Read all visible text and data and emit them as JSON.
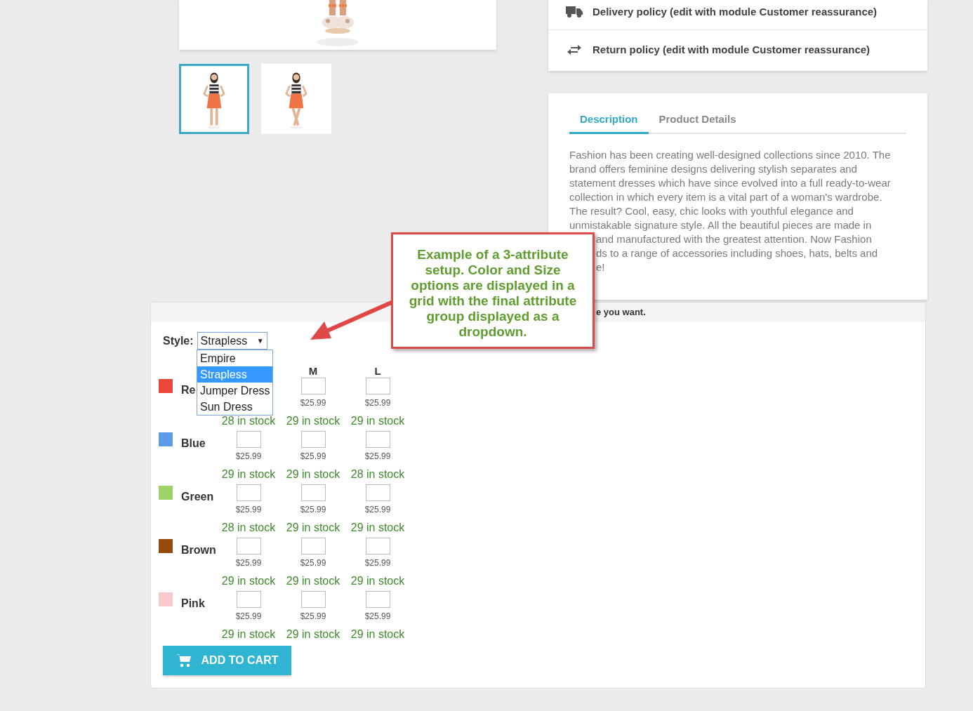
{
  "gallery": {
    "main_image": {
      "kind": "picture"
    },
    "thumbnails": [
      {
        "kind": "picture",
        "selected": true
      },
      {
        "kind": "picture",
        "selected": false
      }
    ]
  },
  "reassurance": [
    {
      "kind": "truck",
      "text": "Delivery policy (edit with module Customer reassurance)"
    },
    {
      "kind": "swap",
      "text": "Return policy (edit with module Customer reassurance)"
    }
  ],
  "tabs": [
    {
      "label": "Description",
      "selected": true
    },
    {
      "label": "Product Details",
      "selected": false
    }
  ],
  "description_lines": [
    {
      "text": "Fashion has been creating well-designed collections since 2010. The",
      "covered": false
    },
    {
      "text": "brand offers feminine designs delivering stylish separates and",
      "covered": false
    },
    {
      "text": "statement dresses which have since evolved into a full ready-to-wear",
      "covered": false
    },
    {
      "text": "collection in which every item is a vital part of a woman's wardrobe.",
      "covered": false
    },
    {
      "text": "The result? Cool, easy, chic looks with youthful elegance and",
      "covered": false
    },
    {
      "text": "unmistakable signature style. All the beautiful pieces are made in",
      "covered": false
    },
    {
      "text": "and manufactured with the greatest attention. Now Fashion",
      "covered": true
    },
    {
      "text": "ds to a range of accessories including shoes, hats, belts and",
      "covered": true
    },
    {
      "text": "e!",
      "covered": true
    }
  ],
  "panel": {
    "header": "e you want.",
    "style_label": "Style:",
    "style_value": "Strapless",
    "style_caret": "▼",
    "style_options": [
      {
        "label": "Empire",
        "selected": false
      },
      {
        "label": "Strapless",
        "selected": true
      },
      {
        "label": "Jumper Dress",
        "selected": false
      },
      {
        "label": "Sun Dress",
        "selected": false
      }
    ],
    "size_headers": [
      "M",
      "L"
    ],
    "rows": [
      {
        "label": "Re",
        "color": "#e8473a",
        "cells": [
          {
            "stock": "28 in stock"
          },
          {
            "price": "$25.99",
            "stock": "29 in stock"
          },
          {
            "price": "$25.99",
            "stock": "29 in stock"
          }
        ]
      },
      {
        "label": "Blue",
        "color": "#5b9be8",
        "cells": [
          {
            "price": "$25.99",
            "stock": "29 in stock"
          },
          {
            "price": "$25.99",
            "stock": "29 in stock"
          },
          {
            "price": "$25.99",
            "stock": "28 in stock"
          }
        ]
      },
      {
        "label": "Green",
        "color": "#9ed36a",
        "cells": [
          {
            "price": "$25.99",
            "stock": "28 in stock"
          },
          {
            "price": "$25.99",
            "stock": "29 in stock"
          },
          {
            "price": "$25.99",
            "stock": "29 in stock"
          }
        ]
      },
      {
        "label": "Brown",
        "color": "#954a0c",
        "cells": [
          {
            "price": "$25.99",
            "stock": "29 in stock"
          },
          {
            "price": "$25.99",
            "stock": "29 in stock"
          },
          {
            "price": "$25.99",
            "stock": "29 in stock"
          }
        ]
      },
      {
        "label": "Pink",
        "color": "#f7c8cc",
        "cells": [
          {
            "price": "$25.99",
            "stock": "29 in stock"
          },
          {
            "price": "$25.99",
            "stock": "29 in stock"
          },
          {
            "price": "$25.99",
            "stock": "29 in stock"
          }
        ]
      }
    ],
    "add_to_cart": "ADD TO CART"
  },
  "callout": "Example of a 3-attribute setup. Color and Size options are displayed in a grid with the final attribute group displayed as a dropdown."
}
